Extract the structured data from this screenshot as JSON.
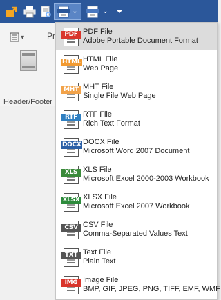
{
  "toolbar": {
    "icons": [
      "export-arrow-icon",
      "print-icon",
      "print-preview-icon",
      "export-document-icon",
      "send-document-icon",
      "customize-toolbar-icon"
    ]
  },
  "ribbon": {
    "tab_label": "Pr",
    "header_footer_label": "Header/Footer"
  },
  "menu": {
    "items": [
      {
        "tag": "PDF",
        "tag_color": "#d9352c",
        "title": "PDF File",
        "subtitle": "Adobe Portable Document Format",
        "selected": true
      },
      {
        "tag": "HTML",
        "tag_color": "#f29b33",
        "title": "HTML File",
        "subtitle": "Web Page"
      },
      {
        "tag": "MHT",
        "tag_color": "#f2a34a",
        "title": "MHT File",
        "subtitle": "Single File Web Page"
      },
      {
        "tag": "RTF",
        "tag_color": "#2f7fc1",
        "title": "RTF File",
        "subtitle": "Rich Text Format"
      },
      {
        "tag": "DOCX",
        "tag_color": "#2b5fa6",
        "title": "DOCX File",
        "subtitle": "Microsoft Word 2007 Document"
      },
      {
        "tag": "XLS",
        "tag_color": "#3a8a3a",
        "title": "XLS File",
        "subtitle": "Microsoft Excel 2000-2003 Workbook"
      },
      {
        "tag": "XLSX",
        "tag_color": "#2e8b3c",
        "title": "XLSX File",
        "subtitle": "Microsoft Excel 2007 Workbook"
      },
      {
        "tag": "CSV",
        "tag_color": "#555555",
        "title": "CSV File",
        "subtitle": "Comma-Separated Values Text"
      },
      {
        "tag": "TXT",
        "tag_color": "#555555",
        "title": "Text File",
        "subtitle": "Plain Text"
      },
      {
        "tag": "IMG",
        "tag_color": "#d9352c",
        "title": "Image File",
        "subtitle": "BMP, GIF, JPEG, PNG, TIFF, EMF, WMF"
      }
    ]
  }
}
